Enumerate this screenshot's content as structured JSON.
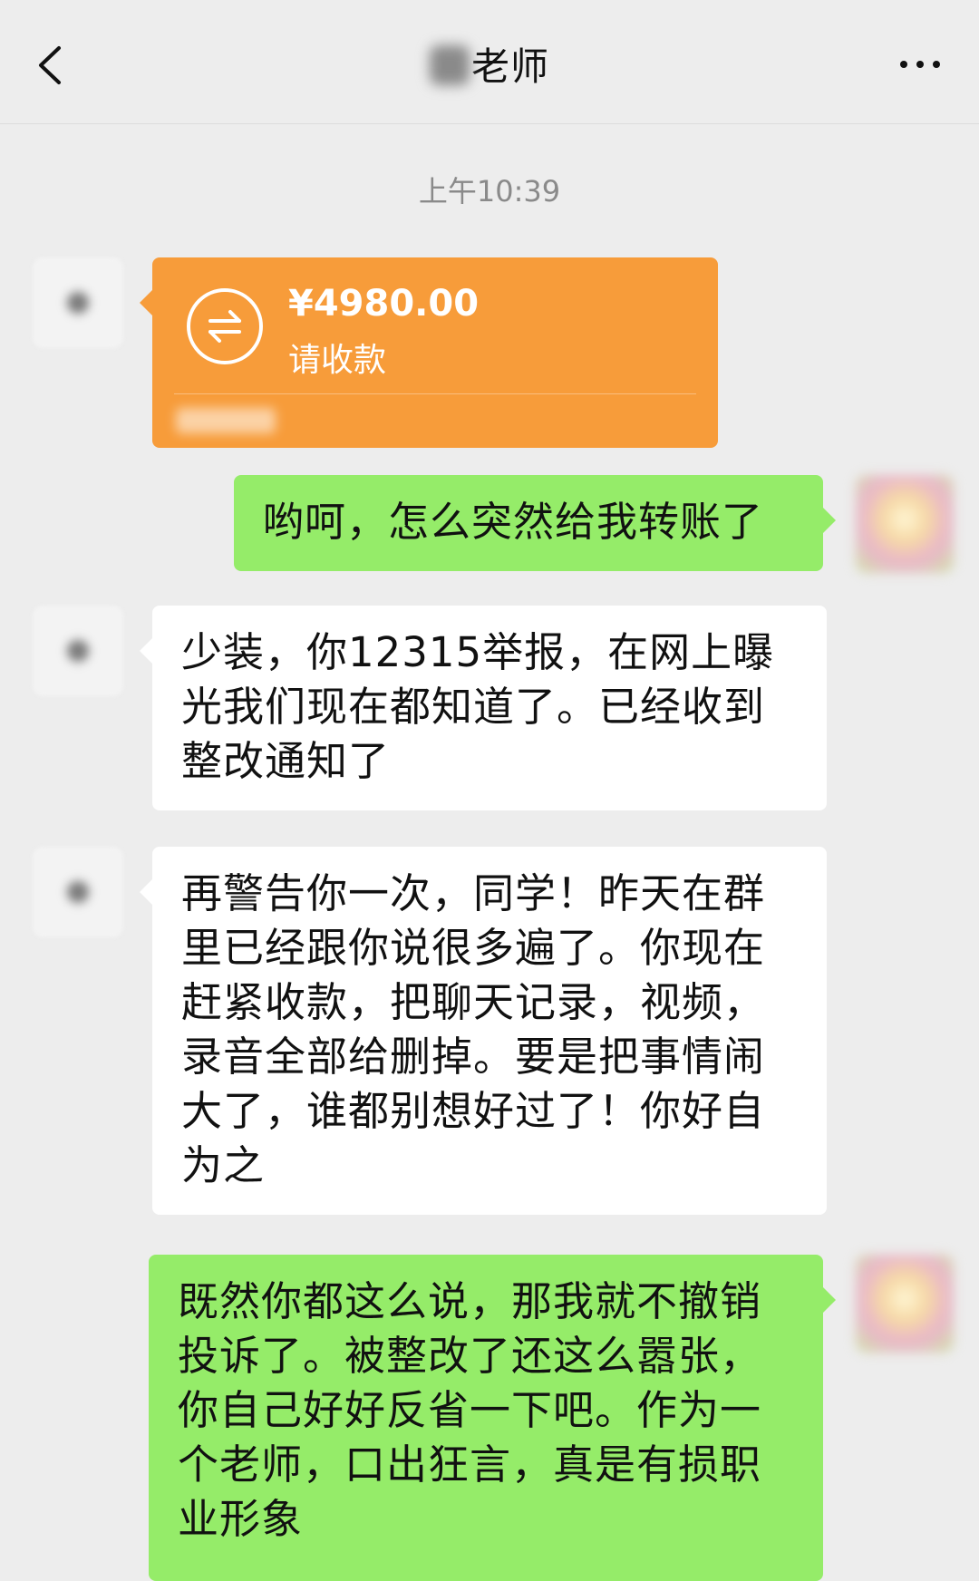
{
  "header": {
    "title_visible": "老师"
  },
  "timestamp": "上午10:39",
  "transfer": {
    "amount": "¥4980.00",
    "status": "请收款"
  },
  "messages": [
    {
      "from": "me",
      "text": "哟呵，怎么突然给我转账了"
    },
    {
      "from": "teacher",
      "text": "少装，你12315举报，在网上曝光我们现在都知道了。已经收到整改通知了"
    },
    {
      "from": "teacher",
      "text": "再警告你一次，同学！昨天在群里已经跟你说很多遍了。你现在赶紧收款，把聊天记录，视频，录音全部给删掉。要是把事情闹大了，谁都别想好过了！你好自为之"
    },
    {
      "from": "me",
      "text": "既然你都这么说，那我就不撤销投诉了。被整改了还这么嚣张，你自己好好反省一下吧。作为一个老师，口出狂言，真是有损职业形象"
    }
  ],
  "colors": {
    "background": "#ededed",
    "sent_bubble": "#95ec69",
    "received_bubble": "#ffffff",
    "transfer_card": "#f79c3a"
  },
  "icons": [
    "back-arrow-icon",
    "more-dots-icon",
    "transfer-arrows-icon"
  ]
}
